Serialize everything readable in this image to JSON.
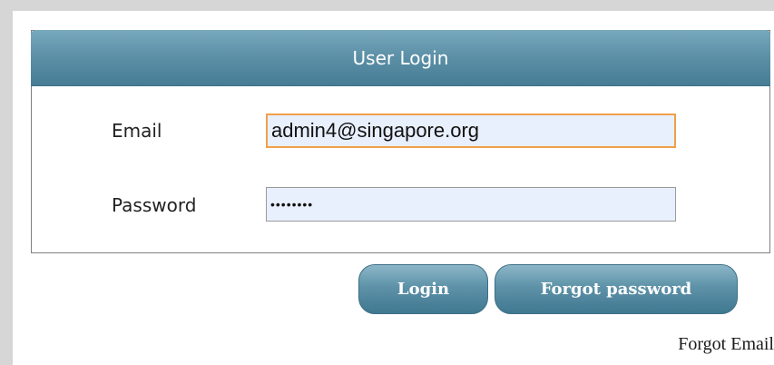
{
  "login": {
    "title": "User Login",
    "email_label": "Email",
    "email_value": "admin4@singapore.org",
    "password_label": "Password",
    "password_value": "••••••••"
  },
  "buttons": {
    "login_label": "Login",
    "forgot_password_label": "Forgot password"
  },
  "links": {
    "forgot_email_label": "Forgot Email"
  },
  "colors": {
    "header_accent": "#5b8fa6",
    "input_background": "#e8effd",
    "focus_border": "#f0a04a",
    "page_background": "#d6d6d6"
  }
}
